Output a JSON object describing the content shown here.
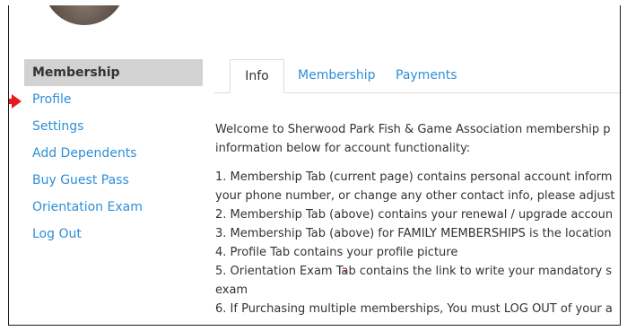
{
  "sidebar": {
    "items": [
      {
        "label": "Membership",
        "active": true
      },
      {
        "label": "Profile",
        "active": false
      },
      {
        "label": "Settings",
        "active": false
      },
      {
        "label": "Add Dependents",
        "active": false
      },
      {
        "label": "Buy Guest Pass",
        "active": false
      },
      {
        "label": "Orientation Exam",
        "active": false
      },
      {
        "label": "Log Out",
        "active": false
      }
    ],
    "arrow_color": "#e8191f"
  },
  "tabs": [
    {
      "label": "Info",
      "active": true
    },
    {
      "label": "Membership",
      "active": false
    },
    {
      "label": "Payments",
      "active": false
    }
  ],
  "content": {
    "intro_1": "Welcome to Sherwood Park Fish & Game Association membership p",
    "intro_2": "information below for account functionality:",
    "line_1": "1. Membership Tab (current page) contains personal account inform",
    "line_1b": "your phone number, or change any other contact info, please adjust",
    "line_2": "2. Membership Tab (above) contains your renewal / upgrade accoun",
    "line_3": "3. Membership Tab (above) for FAMILY MEMBERSHIPS is the location",
    "line_4": "4. Profile Tab contains your profile picture",
    "line_5": "5. Orientation Exam Tab contains the link to write your mandatory s",
    "line_5b": "exam",
    "line_6": "6. If Purchasing multiple memberships, You must LOG OUT of your a"
  },
  "colors": {
    "link": "#2e8fd6",
    "active_bg": "#d2d2d2",
    "text": "#333333",
    "annotation": "#e8191f"
  }
}
